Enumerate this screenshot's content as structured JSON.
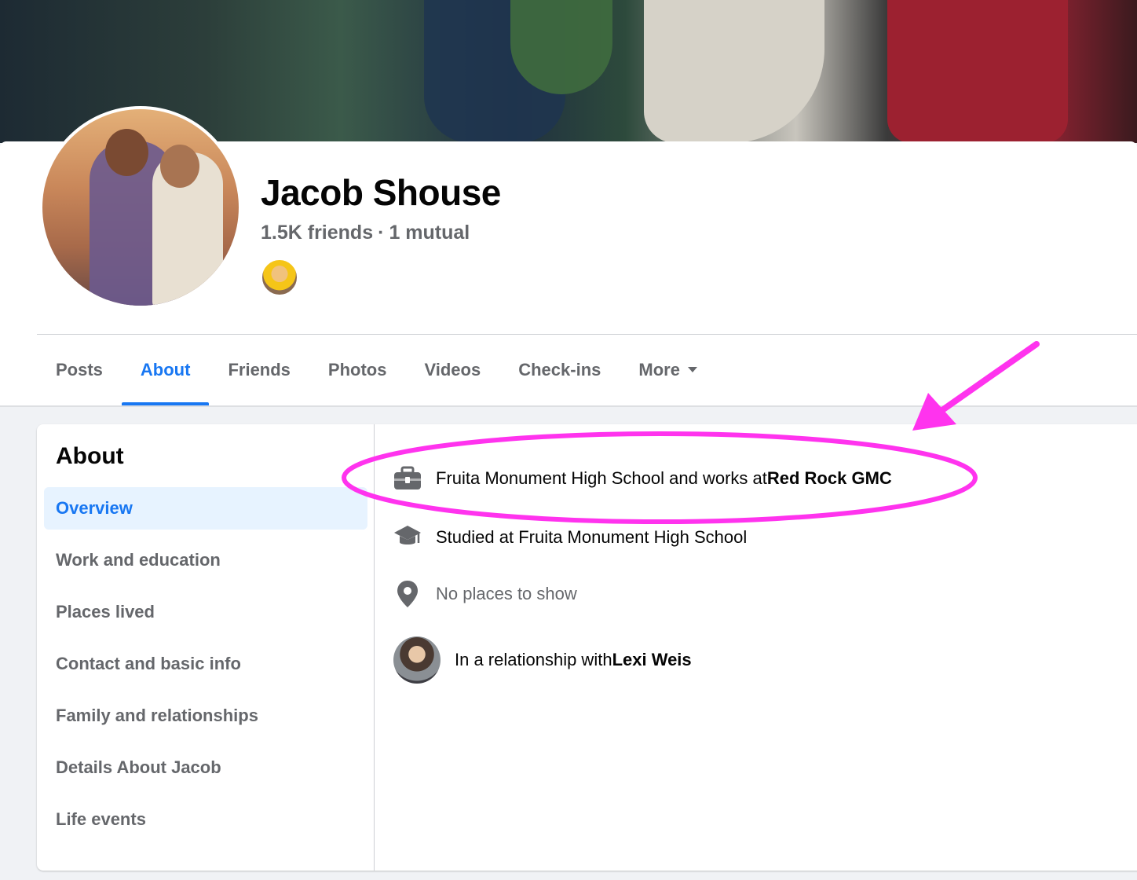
{
  "profile": {
    "name": "Jacob Shouse",
    "friends_count": "1.5K friends",
    "separator": "·",
    "mutual": "1 mutual"
  },
  "tabs": [
    {
      "label": "Posts"
    },
    {
      "label": "About"
    },
    {
      "label": "Friends"
    },
    {
      "label": "Photos"
    },
    {
      "label": "Videos"
    },
    {
      "label": "Check-ins"
    },
    {
      "label": "More"
    }
  ],
  "active_tab": "About",
  "about": {
    "title": "About",
    "nav": [
      {
        "label": "Overview"
      },
      {
        "label": "Work and education"
      },
      {
        "label": "Places lived"
      },
      {
        "label": "Contact and basic info"
      },
      {
        "label": "Family and relationships"
      },
      {
        "label": "Details About Jacob"
      },
      {
        "label": "Life events"
      }
    ],
    "active_nav": "Overview",
    "overview": {
      "work": {
        "prefix": "Fruita Monument High School and works at ",
        "strong": "Red Rock GMC",
        "icon": "briefcase-icon"
      },
      "education": {
        "text": "Studied at Fruita Monument High School",
        "icon": "graduation-cap-icon"
      },
      "places": {
        "text": "No places to show",
        "icon": "location-pin-icon"
      },
      "relationship": {
        "prefix": "In a relationship with ",
        "strong": "Lexi Weis"
      }
    }
  },
  "colors": {
    "accent": "#1877f2",
    "annotation": "#ff33ee",
    "muted_text": "#65676b",
    "active_nav_bg": "#e7f3ff"
  }
}
